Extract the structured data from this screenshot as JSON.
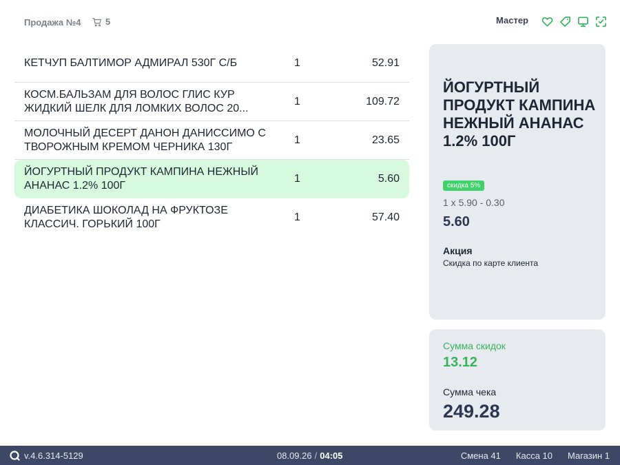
{
  "header": {
    "sale_title": "Продажа №4",
    "cart_count": "5",
    "user_name": "Мастер",
    "icons": [
      "heart-icon",
      "tag-icon",
      "monitor-icon",
      "scan-icon"
    ],
    "accent_color": "#2fb35a"
  },
  "items": [
    {
      "name": "КЕТЧУП БАЛТИМОР АДМИРАЛ 530Г С/Б",
      "qty": "1",
      "sum": "52.91"
    },
    {
      "name": "КОСМ.БАЛЬЗАМ ДЛЯ ВОЛОС ГЛИС КУР ЖИДКИЙ ШЕЛК ДЛЯ ЛОМКИХ ВОЛОС 20...",
      "qty": "1",
      "sum": "109.72"
    },
    {
      "name": "МОЛОЧНЫЙ ДЕСЕРТ ДАНОН ДАНИССИМО С ТВОРОЖНЫМ КРЕМОМ ЧЕРНИКА 130Г",
      "qty": "1",
      "sum": "23.65"
    },
    {
      "name": "ЙОГУРТНЫЙ ПРОДУКТ КАМПИНА НЕЖНЫЙ АНАНАС 1.2% 100Г",
      "qty": "1",
      "sum": "5.60",
      "selected": true
    },
    {
      "name": "ДИАБЕТИКА ШОКОЛАД НА ФРУКТОЗЕ КЛАССИЧ. ГОРЬКИЙ 100Г",
      "qty": "1",
      "sum": "57.40"
    }
  ],
  "detail": {
    "name": "ЙОГУРТНЫЙ ПРОДУКТ КАМПИНА НЕЖНЫЙ АНАНАС 1.2% 100Г",
    "discount_badge": "скидка 5%",
    "formula": "1 x 5.90 - 0.30",
    "price": "5.60",
    "promo_title": "Акция",
    "promo_desc": "Скидка по карте клиента"
  },
  "totals": {
    "discount_label": "Сумма скидок",
    "discount_value": "13.12",
    "total_label": "Сумма чека",
    "total_value": "249.28"
  },
  "statusbar": {
    "version": "v.4.6.314-5129",
    "date": "08.09.26",
    "separator": "/",
    "time": "04:05",
    "shift": "Смена 41",
    "register": "Касса 10",
    "store": "Магазин 1"
  },
  "colors": {
    "selected_row": "#d7fadf",
    "badge": "#3fd16a",
    "panel": "#e7eaef",
    "statusbar": "#3c4866"
  }
}
